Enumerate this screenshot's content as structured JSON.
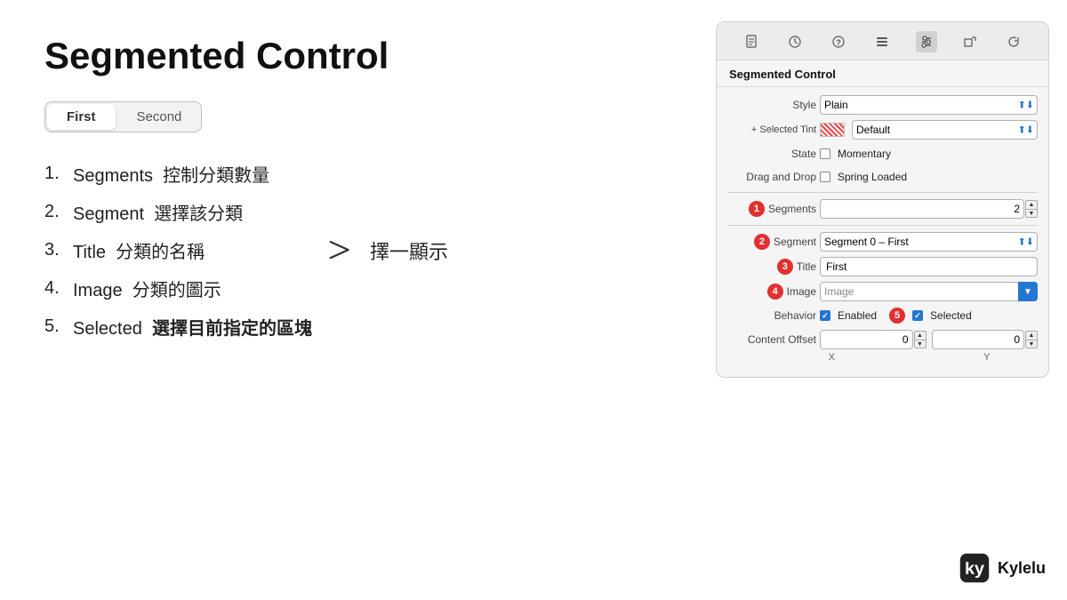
{
  "page": {
    "title": "Segmented Control",
    "bg": "#ffffff"
  },
  "demo": {
    "segment1": "First",
    "segment2": "Second"
  },
  "list": {
    "items": [
      {
        "num": "1.",
        "key": "Segments",
        "desc": "控制分類數量"
      },
      {
        "num": "2.",
        "key": "Segment",
        "desc": "選擇該分類"
      },
      {
        "num": "3.",
        "key": "Title",
        "desc": "分類的名稱"
      },
      {
        "num": "4.",
        "key": "Image",
        "desc": "分類的圖示"
      },
      {
        "num": "5.",
        "key": "Selected",
        "desc": "選擇目前指定的區塊",
        "bold": true
      }
    ],
    "arrow_annotation": "擇一顯示"
  },
  "inspector": {
    "title": "Segmented Control",
    "toolbar_icons": [
      "file",
      "clock",
      "question",
      "list",
      "sliders",
      "shape",
      "refresh"
    ],
    "rows": {
      "style_label": "Style",
      "style_value": "Plain",
      "selected_tint_label": "+ Selected Tint",
      "selected_tint_value": "Default",
      "state_label": "State",
      "momentary_label": "Momentary",
      "drag_drop_label": "Drag and Drop",
      "spring_loaded_label": "Spring Loaded",
      "segments_label": "Segments",
      "segments_value": "2",
      "segment_label": "Segment",
      "segment_value": "Segment 0 – First",
      "title_label": "Title",
      "title_value": "First",
      "image_label": "Image",
      "image_placeholder": "Image",
      "behavior_label": "Behavior",
      "enabled_label": "Enabled",
      "selected_label": "Selected",
      "content_offset_label": "Content Offset",
      "content_offset_x": "0",
      "content_offset_y": "0",
      "x_label": "X",
      "y_label": "Y"
    },
    "badges": {
      "segments": "1",
      "segment": "2",
      "title": "3",
      "image": "4",
      "selected": "5"
    }
  },
  "logo": {
    "text": "Kylelu"
  }
}
